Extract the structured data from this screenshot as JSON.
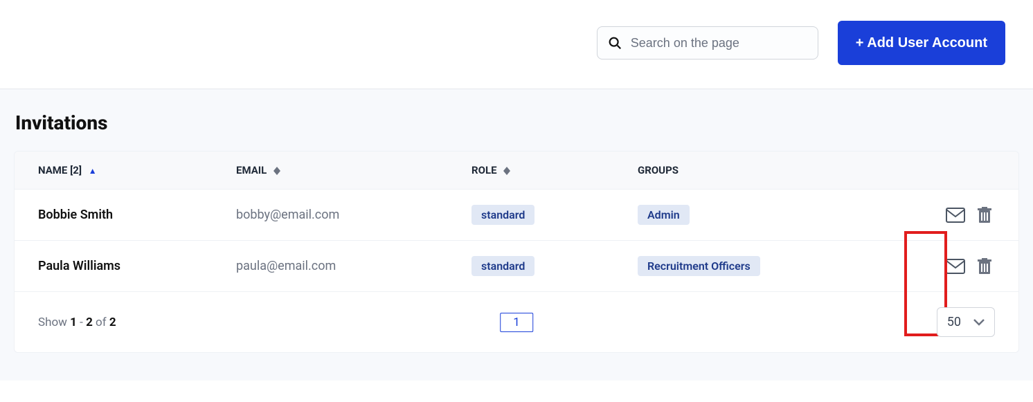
{
  "topbar": {
    "search_placeholder": "Search on the page",
    "add_button_label": "+ Add User Account"
  },
  "section": {
    "title": "Invitations"
  },
  "table": {
    "columns": {
      "name": "NAME [2]",
      "email": "EMAIL",
      "role": "ROLE",
      "groups": "GROUPS"
    },
    "rows": [
      {
        "name": "Bobbie Smith",
        "email": "bobby@email.com",
        "role": "standard",
        "groups": "Admin"
      },
      {
        "name": "Paula Williams",
        "email": "paula@email.com",
        "role": "standard",
        "groups": "Recruitment Officers"
      }
    ]
  },
  "footer": {
    "show_prefix": "Show ",
    "range_from": "1",
    "range_dash": " - ",
    "range_to": "2",
    "of_label": " of ",
    "total": "2",
    "current_page": "1",
    "page_size": "50"
  }
}
